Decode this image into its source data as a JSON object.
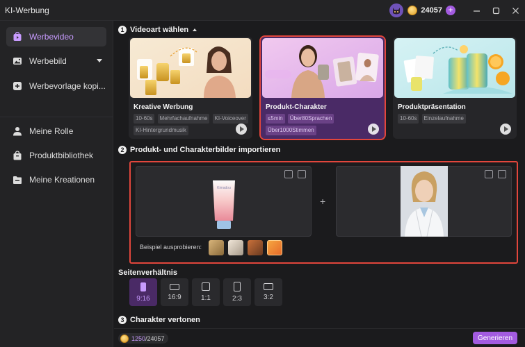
{
  "app": {
    "title": "KI-Werbung"
  },
  "header": {
    "credits": "24057"
  },
  "sidebar": {
    "items": [
      {
        "label": "Werbevideo"
      },
      {
        "label": "Werbebild"
      },
      {
        "label": "Werbevorlage kopi..."
      },
      {
        "label": "Meine Rolle"
      },
      {
        "label": "Produktbibliothek"
      },
      {
        "label": "Meine Kreationen"
      }
    ]
  },
  "section1": {
    "number": "1",
    "title": "Videoart wählen",
    "cards": [
      {
        "title": "Kreative Werbung",
        "tags": [
          "10-60s",
          "Mehrfachaufnahme",
          "KI-Voiceover",
          "KI-Hintergrundmusik"
        ]
      },
      {
        "title": "Produkt-Charakter",
        "tags": [
          "≤5min",
          "Über80Sprachen",
          "Über1000Stimmen"
        ]
      },
      {
        "title": "Produktpräsentation",
        "tags": [
          "10-60s",
          "Einzelaufnahme"
        ]
      }
    ]
  },
  "section2": {
    "number": "2",
    "title": "Produkt- und Charakterbilder importieren",
    "product_brand": "Kimadou",
    "plus": "+",
    "example_label": "Beispiel ausprobieren:"
  },
  "ratio": {
    "title": "Seitenverhältnis",
    "options": [
      "9:16",
      "16:9",
      "1:1",
      "2:3",
      "3:2"
    ]
  },
  "section3": {
    "number": "3",
    "title": "Charakter vertonen"
  },
  "footer": {
    "used": "1250",
    "total": "/24057",
    "generate_label": "Generieren"
  }
}
